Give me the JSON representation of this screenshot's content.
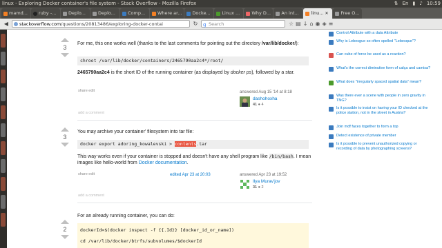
{
  "window": {
    "title": "linux - Exploring Docker container's file system - Stack Overflow - Mozilla Firefox"
  },
  "tray": {
    "time": "10:59"
  },
  "tabs": [
    {
      "label": "mamd..."
    },
    {
      "label": "ruby -..."
    },
    {
      "label": "Deplo..."
    },
    {
      "label": "Deplo..."
    },
    {
      "label": "Comp..."
    },
    {
      "label": "Where ar..."
    },
    {
      "label": "Docke..."
    },
    {
      "label": "Linux ..."
    },
    {
      "label": "Why D..."
    },
    {
      "label": "An int..."
    },
    {
      "label": "linu..."
    },
    {
      "label": "Free O..."
    }
  ],
  "urlbar": {
    "host": "stackoverflow.com",
    "path": "/questions/20813486/exploring-docker-contai",
    "search_placeholder": "Search"
  },
  "answers": [
    {
      "votes": "3",
      "text1_pre": "For me, this one works well (thanks to the last comments for pointing out the directory ",
      "text1_dir": "/var/lib/docker/",
      "text1_post": "):",
      "code": "chroot /var/lib/docker/containers/2465790aa2c4*/root/",
      "text2_id": "2465790aa2c4",
      "text2_mid": " is the short ID of the running container (as displayed by ",
      "text2_cmd": "docker ps",
      "text2_post": "), followed by a star.",
      "share": "share",
      "edit": "edit",
      "answered": "answered Aug 15 '14 at 8:18",
      "user": "dashohoxha",
      "rep": "41",
      "badges": "● 4",
      "add_comment": "add a comment"
    },
    {
      "votes": "3",
      "text1": "You may archive your container' filesystem into tar file:",
      "code_pre": "docker export adoring_kowalevski > ",
      "code_hl": "contents",
      "code_post": ".tar",
      "text2_pre": "This way works even if your container is stopped and doesn't have any shell program like",
      "text2_code": "/bin/bash",
      "text2_mid": ". I mean images like hello-world from ",
      "text2_link": "Docker documentation",
      "text2_post": ".",
      "share": "share",
      "edit": "edit",
      "edited": "edited Apr 23 at 20:03",
      "answered": "answered Apr 23 at 19:52",
      "user": "Ilya Murav'jov",
      "rep": "31",
      "badges": "● 2",
      "add_comment": "add a comment"
    },
    {
      "votes": "2",
      "text1": "For an already running container, you can do:",
      "code1": "dockerId=$(docker inspect -f {{.Id}} [docker_id_or_name])",
      "code2": "cd /var/lib/docker/btrfs/subvolumes/$dockerId"
    }
  ],
  "sidebar": [
    {
      "text": "Control Attribute with a data Attribute",
      "color": "#3b7bbf"
    },
    {
      "text": "Why is Lebesgue so often spelled \"Lebesque\"?",
      "color": "#3b7bbf"
    },
    {
      "text": "Can cube of force be used as a reaction?",
      "color": "#d9534f"
    },
    {
      "text": "What's the correct diminutive form of calça and camisa?",
      "color": "#3b7bbf"
    },
    {
      "text": "What does \"irregularly spaced spatial data\" mean?",
      "color": "#4b9a2c"
    },
    {
      "text": "Was there ever a scene with people in zero gravity in TNG?",
      "color": "#3b7bbf"
    },
    {
      "text": "Is it possible to insist on having your ID checked at the police station, not in the street in Austria?",
      "color": "#3b7bbf"
    },
    {
      "text": "Join mdf faces together to form a top",
      "color": "#3b7bbf"
    },
    {
      "text": "Detect existence of private member",
      "color": "#3b7bbf"
    },
    {
      "text": "Is it possible to prevent unauthorized copying or recording of data by photographing screens?",
      "color": "#3b7bbf"
    }
  ]
}
